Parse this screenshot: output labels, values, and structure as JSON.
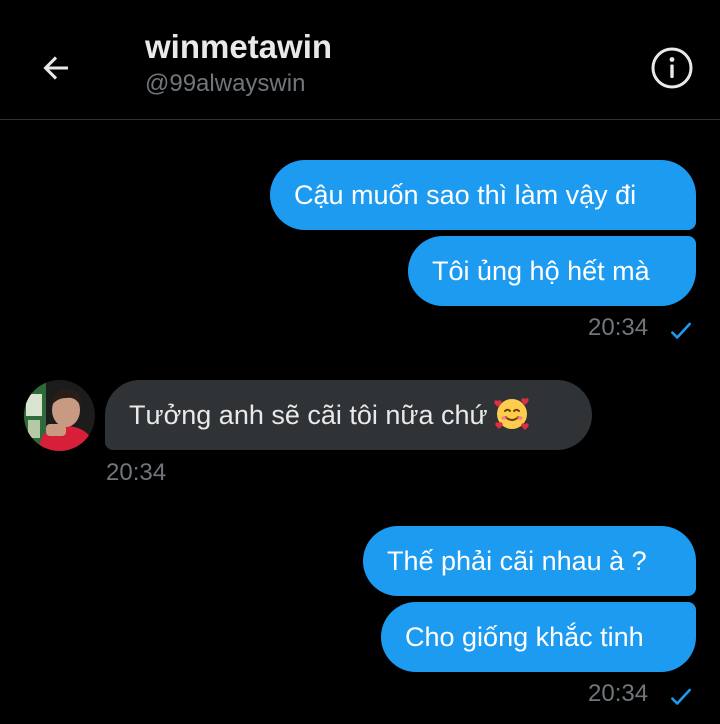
{
  "header": {
    "back_icon": "arrow-left-icon",
    "title": "winmetawin",
    "handle": "@99alwayswin",
    "info_icon": "info-circle-icon"
  },
  "messages": [
    {
      "direction": "sent",
      "text": "Cậu muốn sao thì làm vậy đi"
    },
    {
      "direction": "sent",
      "text": "Tôi ủng hộ hết mà"
    },
    {
      "direction": "received",
      "text": "Tưởng anh sẽ cãi tôi nữa chứ",
      "emoji": "smiling-face-with-hearts"
    },
    {
      "direction": "sent",
      "text": "Thế phải cãi nhau à ?"
    },
    {
      "direction": "sent",
      "text": "Cho giống khắc tinh"
    }
  ],
  "timestamps": [
    "20:34",
    "20:34",
    "20:34"
  ],
  "status_icon": "check-icon",
  "colors": {
    "background": "#000000",
    "sent_bubble": "#1d9bf0",
    "received_bubble": "#2f3336",
    "text_primary": "#e7e9ea",
    "text_secondary": "#71767b"
  }
}
